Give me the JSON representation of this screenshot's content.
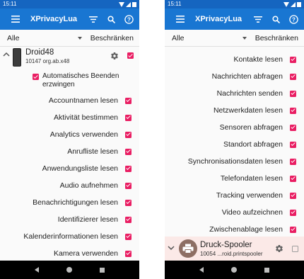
{
  "left": {
    "status": {
      "time": "15:11"
    },
    "appbar": {
      "title": "XPrivacyLua"
    },
    "filter": {
      "selected": "Alle",
      "action_label": "Beschränken"
    },
    "app": {
      "name": "Droid48",
      "package": "10147 org.ab.x48",
      "icon": "device-icon",
      "checked": true
    },
    "force_stop": {
      "label": "Automatisches Beenden erzwingen",
      "checked": true
    },
    "restrictions": [
      "Accountnamen lesen",
      "Aktivität bestimmen",
      "Analytics verwenden",
      "Anrufliste lesen",
      "Anwendungsliste lesen",
      "Audio aufnehmen",
      "Benachrichtigungen lesen",
      "Identifizierer lesen",
      "Kalenderinformationen lesen",
      "Kamera verwenden"
    ]
  },
  "right": {
    "status": {
      "time": "15:11"
    },
    "appbar": {
      "title": "XPrivacyLua"
    },
    "filter": {
      "selected": "Alle",
      "action_label": "Beschränken"
    },
    "restrictions": [
      "Kontakte lesen",
      "Nachrichten abfragen",
      "Nachrichten senden",
      "Netzwerkdaten lesen",
      "Sensoren abfragen",
      "Standort abfragen",
      "Synchronisationsdaten lesen",
      "Telefondaten lesen",
      "Tracking verwenden",
      "Video aufzeichnen",
      "Zwischenablage lesen"
    ],
    "next_app": {
      "name": "Druck-Spooler",
      "package": "10054 ...roid.printspooler",
      "icon": "printer-icon",
      "checked": false
    }
  },
  "colors": {
    "statusbar": "#1565c0",
    "appbar": "#1976d2",
    "checkbox": "#e91e63",
    "highlight_row": "#fbe9e7"
  },
  "icons": {
    "menu": "hamburger-menu-icon",
    "filter": "filter-icon",
    "search": "search-icon",
    "help": "help-icon",
    "settings": "gear-icon",
    "expand": "chevron-up-icon",
    "collapse": "chevron-down-icon"
  }
}
